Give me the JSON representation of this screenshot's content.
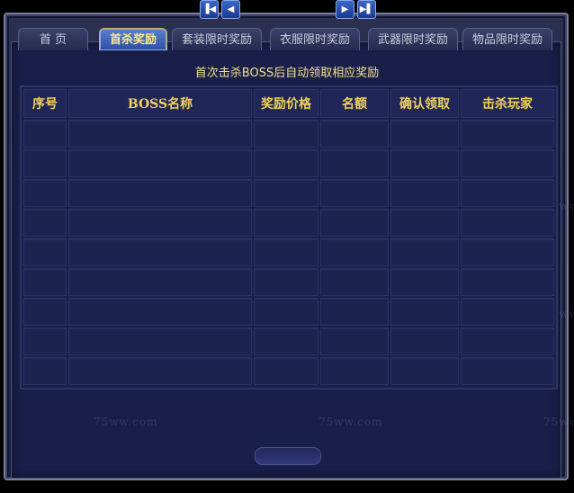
{
  "tabs": [
    {
      "label": "首 页",
      "active": false
    },
    {
      "label": "首杀奖励",
      "active": true
    },
    {
      "label": "套装限时奖励",
      "active": false
    },
    {
      "label": "衣服限时奖励",
      "active": false
    },
    {
      "label": "武器限时奖励",
      "active": false
    },
    {
      "label": "物品限时奖励",
      "active": false
    }
  ],
  "notice": "首次击杀BOSS后自动领取相应奖励",
  "table": {
    "headers": [
      "序号",
      "BOSS名称",
      "奖励价格",
      "名额",
      "确认领取",
      "击杀玩家"
    ],
    "row_count": 9
  },
  "watermark": "75ww.com",
  "pager": {
    "first_icon": "first-page-icon",
    "prev_icon": "prev-page-icon",
    "next_icon": "next-page-icon",
    "last_icon": "last-page-icon",
    "page_value": ""
  },
  "colors": {
    "panel": "#1a1f4a",
    "header_text": "#f0d25c",
    "active_tab": "#2d4ea8",
    "notice_text": "#f2e28a"
  }
}
